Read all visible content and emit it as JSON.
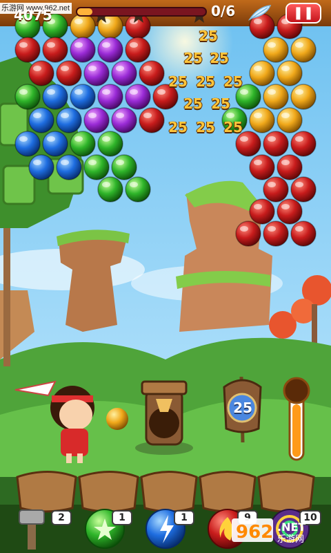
{
  "hud": {
    "score": "4075",
    "goal": "0/6",
    "progress": 0.12,
    "pause_icon": "pause-icon",
    "feather_icon": "feather-icon"
  },
  "watermark": "乐游网 www.962.net",
  "pops": [
    "25",
    "25",
    "25",
    "25",
    "25",
    "25",
    "25",
    "25",
    "25",
    "25",
    "25"
  ],
  "cannon_badge": "25",
  "powerups": [
    {
      "icon": "hammer-icon",
      "count": "2"
    },
    {
      "icon": "green-star-bubble-icon",
      "count": "1"
    },
    {
      "icon": "lightning-bubble-icon",
      "count": "1"
    },
    {
      "icon": "fire-bubble-icon",
      "count": "9"
    },
    {
      "icon": "rainbow-bubble-icon",
      "count": "10"
    }
  ],
  "logo": {
    "brand": "962",
    "suffix": ".NET",
    "sub": "乐游网"
  },
  "colors": {
    "red": "#c81c1c",
    "purple": "#9a2bd6",
    "blue": "#1e6de0",
    "green": "#2fb52a",
    "yellow": "#f0a81a",
    "sky": "#8fd0f5",
    "hud_bar": "#7a1520",
    "pause": "#d81e26"
  }
}
